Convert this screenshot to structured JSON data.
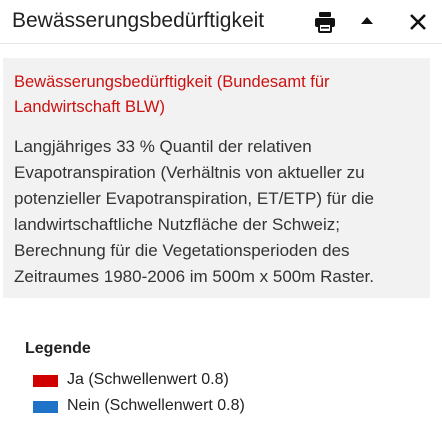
{
  "header": {
    "title": "Bewässerungsbedürftigkeit",
    "icons": [
      "print-icon",
      "collapse-icon",
      "close-icon"
    ]
  },
  "info": {
    "source": "Bewässerungsbedürftigkeit (Bundesamt für Landwirtschaft BLW)",
    "description": "Langjähriges 33 % Quantil der relativen Evapotranspiration (Verhältnis von aktueller zu potenzieller Evapotranspiration, ET/ETP) für die landwirtschaftliche Nutzfläche der Schweiz; Berechnung für die Vegetationsperioden des Zeitraumes 1980-2006 im 500m x 500m Raster."
  },
  "legend": {
    "title": "Legende",
    "items": [
      {
        "label": "Ja (Schwellenwert 0.8)",
        "color": "#d10000"
      },
      {
        "label": "Nein (Schwellenwert 0.8)",
        "color": "#1e73c8"
      }
    ]
  },
  "colors": {
    "source_text": "#cc1111",
    "panel_bg": "#f2f2f2"
  }
}
